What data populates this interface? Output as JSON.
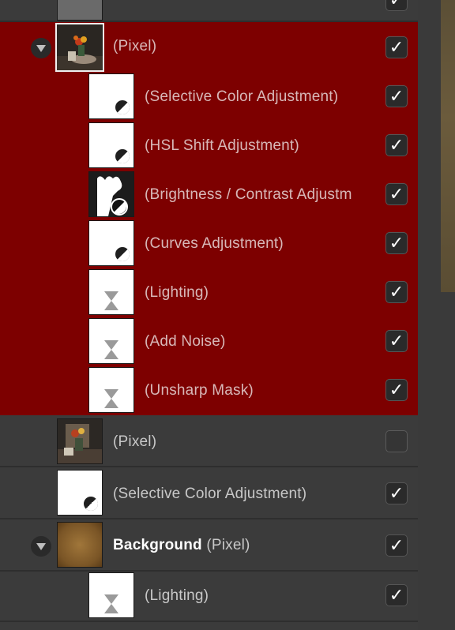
{
  "layers": [
    {
      "label": "(Selective Color Adjustment)",
      "checked": true
    },
    {
      "label": "(HSL Shift Adjustment)",
      "checked": true
    },
    {
      "label": "(Brightness / Contrast Adjustment)",
      "checked": true
    },
    {
      "label": "(Curves Adjustment)",
      "checked": true
    },
    {
      "label": "(Lighting)",
      "checked": true
    },
    {
      "label": "(Add Noise)",
      "checked": true
    },
    {
      "label": "(Unsharp Mask)",
      "checked": true
    }
  ],
  "group_layer": {
    "label": "(Pixel)",
    "checked": true
  },
  "pixel_layer": {
    "label": "(Pixel)",
    "checked": false
  },
  "selcolor_layer": {
    "label": "(Selective Color Adjustment)",
    "checked": true
  },
  "background_layer": {
    "name": "Background",
    "type": "(Pixel)",
    "checked": true
  },
  "bg_lighting_layer": {
    "label": "(Lighting)",
    "checked": true
  },
  "checkmark": "✓",
  "colors": {
    "selected": "#7d0000",
    "panel": "#3b3b3b"
  },
  "icons": {
    "expander": "triangle-down",
    "adjustment": "half-circle",
    "filter": "hourglass"
  }
}
